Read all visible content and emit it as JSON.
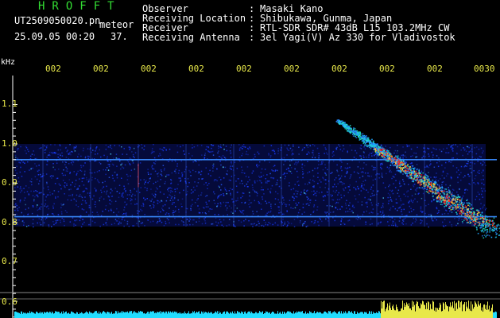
{
  "header": {
    "brand": "HROFFT",
    "filename": "UT2509050020.pn",
    "mode": "meteor",
    "datetime": "25.09.05 00:20",
    "count": "37.",
    "fields": [
      {
        "label": "Observer",
        "sep": ":",
        "value": "Masaki Kano"
      },
      {
        "label": "Receiving Location",
        "sep": ":",
        "value": "Shibukawa, Gunma, Japan"
      },
      {
        "label": "Receiver",
        "sep": ":",
        "value": "RTL-SDR SDR# 43dB L15 103.2MHz CW"
      },
      {
        "label": "Receiving Antenna",
        "sep": ":",
        "value": "3el Yagi(V) Az 330 for Vladivostok"
      }
    ]
  },
  "axis": {
    "unit": "kHz",
    "y_ticks": [
      "1.1",
      "1.0",
      "0.9",
      "0.8",
      "0.7",
      "0.6"
    ],
    "time_ticks": [
      "002",
      "002",
      "002",
      "002",
      "002",
      "002",
      "002",
      "002",
      "002",
      "0030"
    ]
  },
  "colors": {
    "background": "#000000",
    "text": "#ffffff",
    "accent_yellow": "#e8e84a",
    "brand_green": "#33dd33",
    "noise_blue": "#1a3cff",
    "signal_red": "#ff2020",
    "bottom_bar_cyan": "#22ddff"
  },
  "spectrogram": {
    "band_low_khz": 0.79,
    "band_high_khz": 1.0,
    "carrier_lines_khz": [
      0.96,
      0.815
    ],
    "meteor_start_khz": 1.06,
    "meteor_end_khz": 0.78
  }
}
